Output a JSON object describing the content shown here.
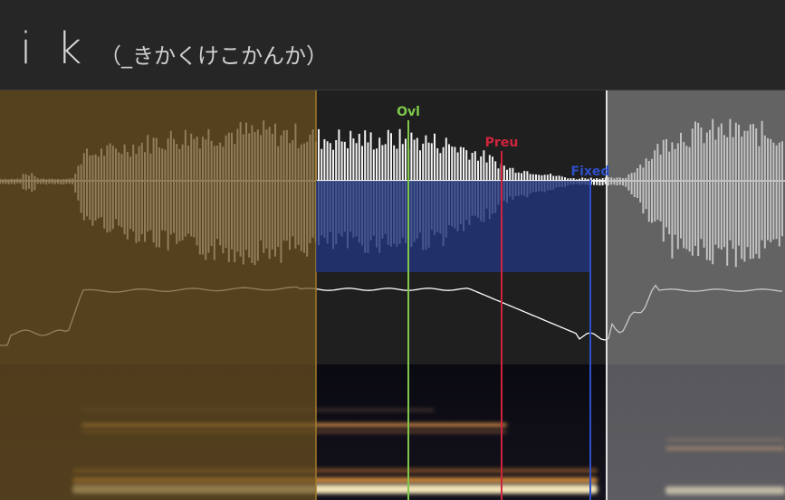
{
  "header": {
    "alias": "i k",
    "filename": "（_きかくけこかんか）"
  },
  "markers": {
    "overlap": {
      "label": "Ovl",
      "color": "#7ec84a"
    },
    "preutterance": {
      "label": "Preu",
      "color": "#d0243c"
    },
    "fixed": {
      "label": "Fixed",
      "color": "#2e4fc8"
    }
  },
  "colors": {
    "offset_region": "#4a3a1c",
    "consonant_region": "#1e2c66",
    "cutoff_region": "#6e6e6e",
    "waveform": "#f2f2f2",
    "pitch_curve": "#ffffff"
  }
}
